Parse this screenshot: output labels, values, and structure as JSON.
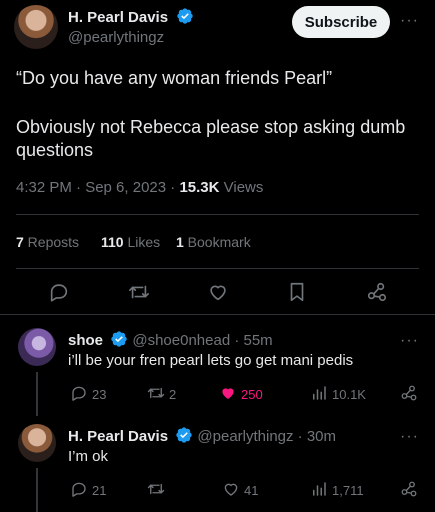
{
  "main_tweet": {
    "author_name": "H. Pearl Davis",
    "handle": "@pearlythingz",
    "subscribe_label": "Subscribe",
    "more": "···",
    "text_line1": "“Do you have any woman friends Pearl”",
    "text_line2": "Obviously not Rebecca please stop asking dumb questions",
    "time": "4:32 PM · Sep 6, 2023 · ",
    "views_count": "15.3K",
    "views_label": " Views",
    "reposts_count": "7",
    "reposts_label": " Reposts",
    "likes_count": "110",
    "likes_label": " Likes",
    "bookmarks_count": "1",
    "bookmarks_label": " Bookmark"
  },
  "replies": [
    {
      "author_name": "shoe",
      "handle_time": "@shoe0nhead · 55m",
      "text": "i’ll be your fren pearl lets go get mani pedis",
      "replies": "23",
      "reposts": "2",
      "likes": "250",
      "views": "10.1K",
      "more": "···"
    },
    {
      "author_name": "H. Pearl Davis",
      "handle_time": "@pearlythingz · 30m",
      "text": "I’m ok",
      "replies": "21",
      "reposts": "",
      "likes": "41",
      "views": "1,711",
      "more": "···"
    }
  ],
  "colors": {
    "verified": "#1d9bf0",
    "like_active": "#f91880",
    "muted": "#71767b",
    "divider": "#2f3336"
  }
}
